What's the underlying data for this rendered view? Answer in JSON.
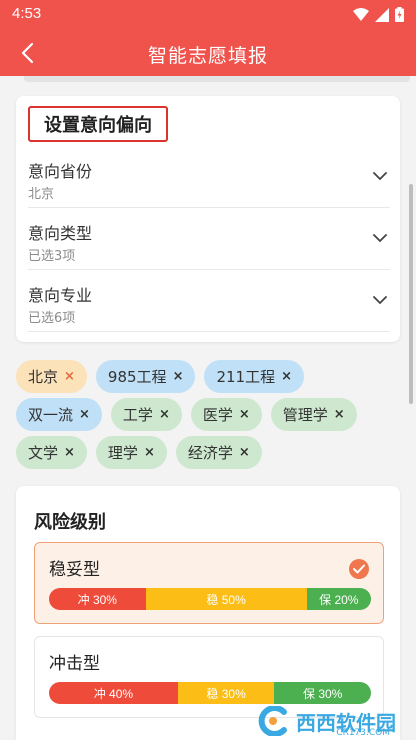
{
  "status_bar": {
    "time": "4:53"
  },
  "app_bar": {
    "title": "智能志愿填报"
  },
  "settings": {
    "title": "设置意向偏向",
    "rows": [
      {
        "label": "意向省份",
        "value": "北京"
      },
      {
        "label": "意向类型",
        "value": "已选3项"
      },
      {
        "label": "意向专业",
        "value": "已选6项"
      }
    ]
  },
  "tags": {
    "remove_symbol": "×",
    "items": [
      {
        "label": "北京",
        "color": "#fce2b8"
      },
      {
        "label": "985工程",
        "color": "#bfe0f6"
      },
      {
        "label": "211工程",
        "color": "#bfe0f6"
      },
      {
        "label": "双一流",
        "color": "#bfe0f6"
      },
      {
        "label": "工学",
        "color": "#cde8cf"
      },
      {
        "label": "医学",
        "color": "#cde8cf"
      },
      {
        "label": "管理学",
        "color": "#cde8cf"
      },
      {
        "label": "文学",
        "color": "#cde8cf"
      },
      {
        "label": "理学",
        "color": "#cde8cf"
      },
      {
        "label": "经济学",
        "color": "#cde8cf"
      }
    ]
  },
  "risk": {
    "title": "风险级别",
    "options": [
      {
        "name": "稳妥型",
        "selected": true,
        "segments": [
          {
            "label": "冲 30%",
            "share": 0.3,
            "color": "#ef4b3b"
          },
          {
            "label": "稳 50%",
            "share": 0.5,
            "color": "#fbbd16"
          },
          {
            "label": "保 20%",
            "share": 0.2,
            "color": "#4caf50"
          }
        ]
      },
      {
        "name": "冲击型",
        "selected": false,
        "segments": [
          {
            "label": "冲 40%",
            "share": 0.4,
            "color": "#ef4b3b"
          },
          {
            "label": "稳 30%",
            "share": 0.3,
            "color": "#fbbd16"
          },
          {
            "label": "保 30%",
            "share": 0.3,
            "color": "#4caf50"
          }
        ]
      }
    ]
  },
  "watermark": {
    "text": "西西软件园",
    "sub": "CR173.COM"
  },
  "colors": {
    "primary": "#f0524c",
    "highlight": "#d9352c",
    "accent": "#f0774d"
  }
}
